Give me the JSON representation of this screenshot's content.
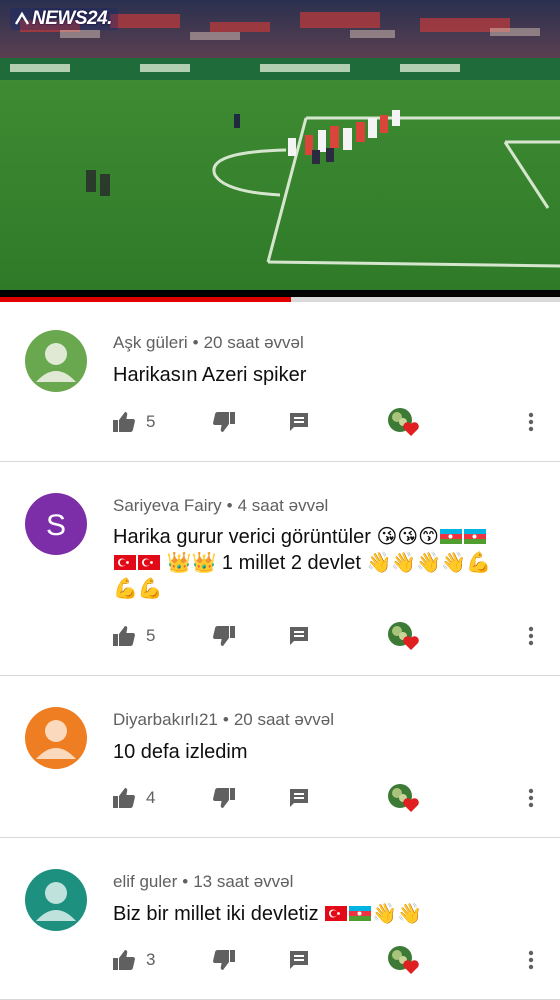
{
  "player": {
    "channel_logo": "NEWS24.",
    "progress_fraction": 0.52,
    "accent": "#e00000",
    "pitch_color": "#3d8a2e"
  },
  "comments": [
    {
      "author": "Aşk güleri",
      "separator": "•",
      "time": "20 saat əvvəl",
      "avatar_type": "default-person",
      "avatar_color": "#6aa84f",
      "text": "Harikasın Azeri spiker",
      "likes": "5",
      "creator_hearted": true
    },
    {
      "author": "Sariyeva Fairy",
      "separator": "•",
      "time": "4 saat əvvəl",
      "avatar_type": "letter",
      "avatar_letter": "S",
      "avatar_color": "#7b2ea8",
      "text_segments": [
        "Harika gurur verici görüntüler ",
        "😘😘😙",
        "",
        "",
        " ",
        "👑👑",
        " 1 millet 2 devlet ",
        "👋👋👋👋💪",
        "💪💪"
      ],
      "likes": "5",
      "creator_hearted": true
    },
    {
      "author": "Diyarbakırlı21",
      "separator": "•",
      "time": "20 saat əvvəl",
      "avatar_type": "default-person",
      "avatar_color": "#ef7d22",
      "text": "10 defa izledim",
      "likes": "4",
      "creator_hearted": true
    },
    {
      "author": "elif guler",
      "separator": "•",
      "time": "13 saat əvvəl",
      "avatar_type": "default-person",
      "avatar_color": "#1e9080",
      "text_main": "Biz bir millet iki devletiz ",
      "text_emoji": "👋👋",
      "likes": "3",
      "creator_hearted": true
    }
  ],
  "icons": {
    "like": "thumb-up-icon",
    "dislike": "thumb-down-icon",
    "reply": "reply-comment-icon",
    "heart": "creator-heart-icon",
    "more": "more-vertical-icon"
  }
}
